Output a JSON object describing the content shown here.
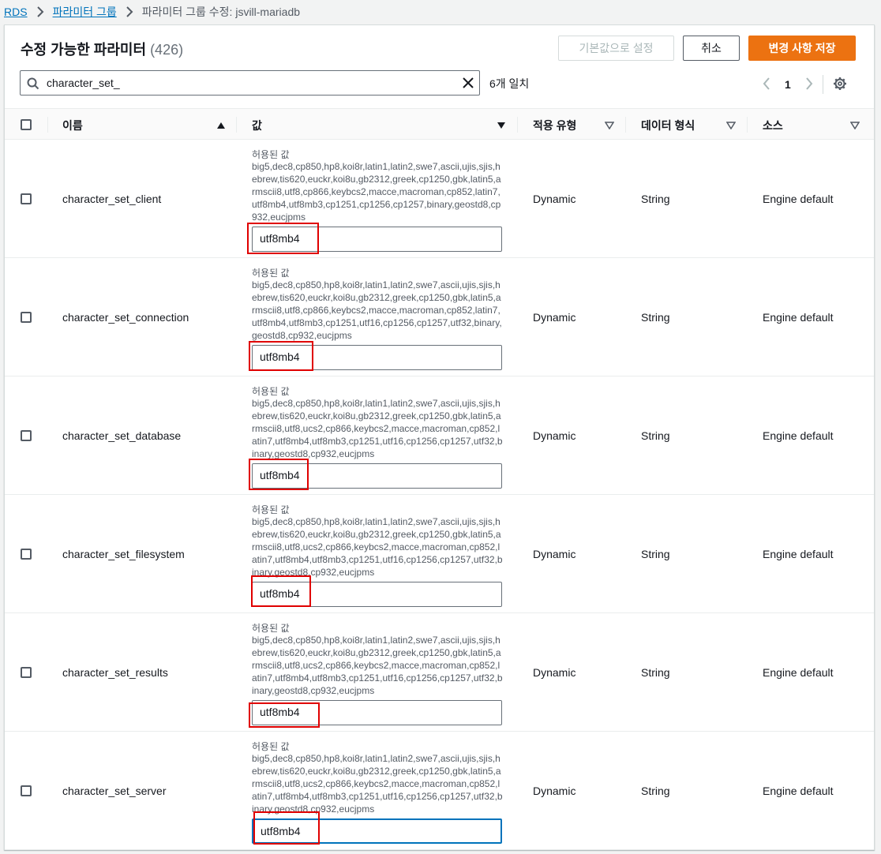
{
  "breadcrumb": {
    "items": [
      "RDS",
      "파라미터 그룹"
    ],
    "current": "파라미터 그룹 수정: jsvill-mariadb"
  },
  "header": {
    "title": "수정 가능한 파라미터",
    "count": "(426)",
    "default_button": "기본값으로 설정",
    "cancel_button": "취소",
    "save_button": "변경 사항 저장"
  },
  "search": {
    "value": "character_set_",
    "match_text": "6개 일치"
  },
  "pagination": {
    "current_page": "1"
  },
  "table": {
    "columns": [
      "이름",
      "값",
      "적용 유형",
      "데이터 형식",
      "소스"
    ],
    "allowed_label": "허용된 값",
    "rows": [
      {
        "name": "character_set_client",
        "allowed": "big5,dec8,cp850,hp8,koi8r,latin1,latin2,swe7,ascii,ujis,sjis,hebrew,tis620,euckr,koi8u,gb2312,greek,cp1250,gbk,latin5,armscii8,utf8,cp866,keybcs2,macce,macroman,cp852,latin7,utf8mb4,utf8mb3,cp1251,cp1256,cp1257,binary,geostd8,cp932,eucjpms",
        "value": "utf8mb4",
        "apply_type": "Dynamic",
        "data_type": "String",
        "source": "Engine default"
      },
      {
        "name": "character_set_connection",
        "allowed": "big5,dec8,cp850,hp8,koi8r,latin1,latin2,swe7,ascii,ujis,sjis,hebrew,tis620,euckr,koi8u,gb2312,greek,cp1250,gbk,latin5,armscii8,utf8,cp866,keybcs2,macce,macroman,cp852,latin7,utf8mb4,utf8mb3,cp1251,utf16,cp1256,cp1257,utf32,binary,geostd8,cp932,eucjpms",
        "value": "utf8mb4",
        "apply_type": "Dynamic",
        "data_type": "String",
        "source": "Engine default"
      },
      {
        "name": "character_set_database",
        "allowed": "big5,dec8,cp850,hp8,koi8r,latin1,latin2,swe7,ascii,ujis,sjis,hebrew,tis620,euckr,koi8u,gb2312,greek,cp1250,gbk,latin5,armscii8,utf8,ucs2,cp866,keybcs2,macce,macroman,cp852,latin7,utf8mb4,utf8mb3,cp1251,utf16,cp1256,cp1257,utf32,binary,geostd8,cp932,eucjpms",
        "value": "utf8mb4",
        "apply_type": "Dynamic",
        "data_type": "String",
        "source": "Engine default"
      },
      {
        "name": "character_set_filesystem",
        "allowed": "big5,dec8,cp850,hp8,koi8r,latin1,latin2,swe7,ascii,ujis,sjis,hebrew,tis620,euckr,koi8u,gb2312,greek,cp1250,gbk,latin5,armscii8,utf8,ucs2,cp866,keybcs2,macce,macroman,cp852,latin7,utf8mb4,utf8mb3,cp1251,utf16,cp1256,cp1257,utf32,binary,geostd8,cp932,eucjpms",
        "value": "utf8mb4",
        "apply_type": "Dynamic",
        "data_type": "String",
        "source": "Engine default"
      },
      {
        "name": "character_set_results",
        "allowed": "big5,dec8,cp850,hp8,koi8r,latin1,latin2,swe7,ascii,ujis,sjis,hebrew,tis620,euckr,koi8u,gb2312,greek,cp1250,gbk,latin5,armscii8,utf8,ucs2,cp866,keybcs2,macce,macroman,cp852,latin7,utf8mb4,utf8mb3,cp1251,utf16,cp1256,cp1257,utf32,binary,geostd8,cp932,eucjpms",
        "value": "utf8mb4",
        "apply_type": "Dynamic",
        "data_type": "String",
        "source": "Engine default"
      },
      {
        "name": "character_set_server",
        "allowed": "big5,dec8,cp850,hp8,koi8r,latin1,latin2,swe7,ascii,ujis,sjis,hebrew,tis620,euckr,koi8u,gb2312,greek,cp1250,gbk,latin5,armscii8,utf8,ucs2,cp866,keybcs2,macce,macroman,cp852,latin7,utf8mb4,utf8mb3,cp1251,utf16,cp1256,cp1257,utf32,binary,geostd8,cp932,eucjpms",
        "value": "utf8mb4",
        "apply_type": "Dynamic",
        "data_type": "String",
        "source": "Engine default"
      }
    ]
  },
  "colors": {
    "primary_orange": "#ec7211",
    "link_blue": "#0073bb",
    "annotation_red": "#e00000"
  }
}
